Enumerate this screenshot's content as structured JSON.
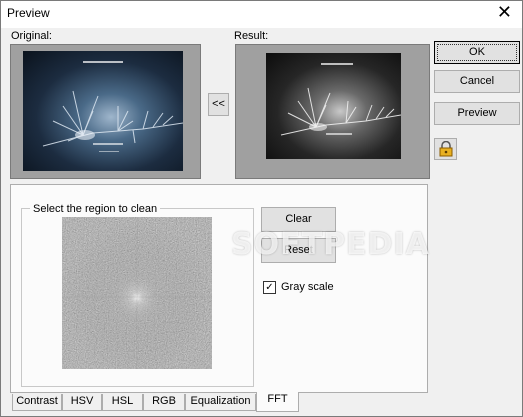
{
  "window": {
    "title": "Preview",
    "close_glyph": "✕"
  },
  "labels": {
    "original": "Original:",
    "result": "Result:"
  },
  "buttons": {
    "ok": "OK",
    "cancel": "Cancel",
    "preview": "Preview",
    "copy_back": "<<",
    "clear": "Clear",
    "reset": "Reset"
  },
  "group": {
    "legend": "Select the region to clean"
  },
  "checkbox": {
    "label": "Gray scale",
    "checked": true,
    "mark": "✓"
  },
  "tabs": [
    {
      "label": "Contrast"
    },
    {
      "label": "HSV"
    },
    {
      "label": "HSL"
    },
    {
      "label": "RGB"
    },
    {
      "label": "Equalization"
    },
    {
      "label": "FFT"
    }
  ],
  "active_tab": "FFT",
  "watermark": "SOFTPEDIA",
  "icons": {
    "lock": "lock-icon"
  },
  "colors": {
    "panel_bg": "#f0f0f0",
    "tab_bg": "#fbfbfb",
    "accent": "#0078d7"
  }
}
